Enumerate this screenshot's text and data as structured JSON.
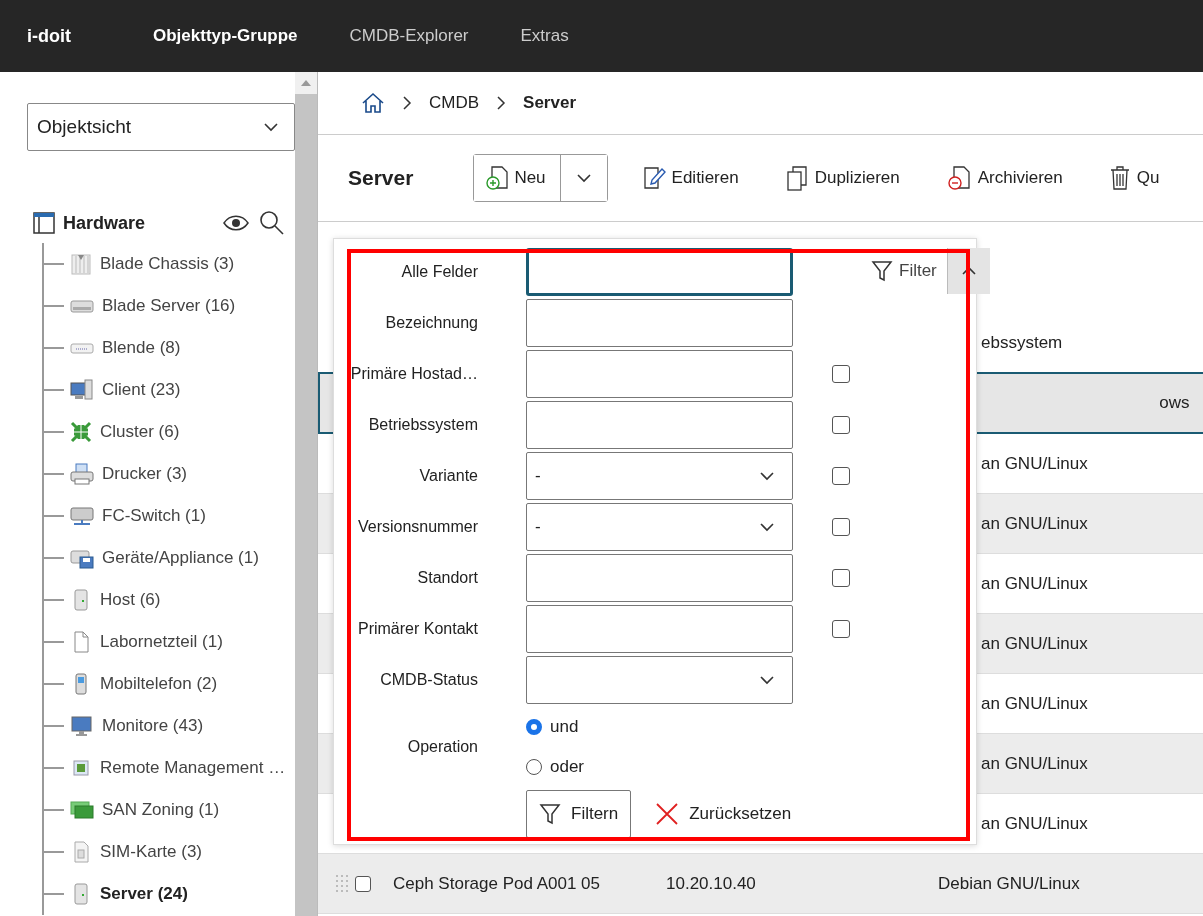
{
  "topbar": {
    "logo": "i-doit",
    "nav": [
      {
        "label": "Objekttyp-Gruppe",
        "selected": true
      },
      {
        "label": "CMDB-Explorer",
        "selected": false
      },
      {
        "label": "Extras",
        "selected": false
      }
    ]
  },
  "sidebar": {
    "view_select": "Objektsicht",
    "tree": {
      "label": "Hardware",
      "children": [
        {
          "label": "Blade Chassis (3)",
          "kind": "chassis",
          "selected": false
        },
        {
          "label": "Blade Server (16)",
          "kind": "blade",
          "selected": false
        },
        {
          "label": "Blende (8)",
          "kind": "panel",
          "selected": false
        },
        {
          "label": "Client (23)",
          "kind": "client",
          "selected": false
        },
        {
          "label": "Cluster (6)",
          "kind": "cluster",
          "selected": false
        },
        {
          "label": "Drucker (3)",
          "kind": "printer",
          "selected": false
        },
        {
          "label": "FC-Switch (1)",
          "kind": "switch",
          "selected": false
        },
        {
          "label": "Geräte/Appliance (1)",
          "kind": "appliance",
          "selected": false
        },
        {
          "label": "Host (6)",
          "kind": "host",
          "selected": false
        },
        {
          "label": "Labornetzteil (1)",
          "kind": "file",
          "selected": false
        },
        {
          "label": "Mobiltelefon (2)",
          "kind": "phone",
          "selected": false
        },
        {
          "label": "Monitore (43)",
          "kind": "monitor",
          "selected": false
        },
        {
          "label": "Remote Management …",
          "kind": "remote",
          "selected": false
        },
        {
          "label": "SAN Zoning (1)",
          "kind": "san",
          "selected": false
        },
        {
          "label": "SIM-Karte (3)",
          "kind": "sim",
          "selected": false
        },
        {
          "label": "Server (24)",
          "kind": "host",
          "selected": true
        }
      ]
    }
  },
  "breadcrumb": [
    {
      "label": "CMDB",
      "current": false
    },
    {
      "label": "Server",
      "current": true
    }
  ],
  "toolbar": {
    "title": "Server",
    "buttons": [
      {
        "label": "Neu",
        "kind": "new"
      },
      {
        "label": "Editieren",
        "kind": "edit"
      },
      {
        "label": "Duplizieren",
        "kind": "duplicate"
      },
      {
        "label": "Archivieren",
        "kind": "archive"
      },
      {
        "label": "Qu",
        "kind": "delete"
      }
    ]
  },
  "table": {
    "columns": [
      {
        "label": "ebssystem"
      }
    ],
    "rows": [
      {
        "selected": true,
        "cells": {
          "column_4": "ows"
        }
      },
      {
        "selected": false,
        "cells": {
          "column_4": "an GNU/Linux"
        }
      },
      {
        "selected": false,
        "cells": {
          "column_4": "an GNU/Linux"
        }
      },
      {
        "selected": false,
        "cells": {
          "column_4": "an GNU/Linux"
        }
      },
      {
        "selected": false,
        "cells": {
          "column_4": "an GNU/Linux"
        }
      },
      {
        "selected": false,
        "cells": {
          "column_4": "an GNU/Linux"
        }
      },
      {
        "selected": false,
        "cells": {
          "column_4": "an GNU/Linux"
        }
      },
      {
        "selected": false,
        "cells": {
          "column_4": "an GNU/Linux"
        }
      },
      {
        "selected": false,
        "checked": false,
        "cells": {
          "column_2": "Ceph Storage Pod A001 05",
          "column_3": "10.20.10.40",
          "column_4": "Debian GNU/Linux"
        }
      }
    ]
  },
  "filter_panel": {
    "toggle": {
      "label": "Filter",
      "expanded": true
    },
    "fields": [
      {
        "label": "Alle Felder",
        "kind": "text",
        "focused": true
      },
      {
        "label": "Bezeichnung",
        "kind": "text",
        "focused": false
      },
      {
        "label": "Primäre Hostad…",
        "kind": "text",
        "focused": false,
        "checked": false
      },
      {
        "label": "Betriebssystem",
        "kind": "text",
        "focused": false,
        "checked": false
      },
      {
        "label": "Variante",
        "kind": "select",
        "value": "-",
        "focused": false,
        "checked": false
      },
      {
        "label": "Versionsnummer",
        "kind": "select",
        "value": "-",
        "focused": false,
        "checked": false
      },
      {
        "label": "Standort",
        "kind": "text",
        "focused": false,
        "checked": false
      },
      {
        "label": "Primärer Kontakt",
        "kind": "text",
        "focused": false,
        "checked": false
      },
      {
        "label": "CMDB-Status",
        "kind": "select",
        "focused": false
      },
      {
        "label": "Operation",
        "kind": "radio",
        "options": [
          {
            "label": "und",
            "selected": true
          },
          {
            "label": "oder",
            "selected": false
          }
        ]
      }
    ],
    "buttons": [
      {
        "label": "Filtern",
        "kind": "apply"
      },
      {
        "label": "Zurücksetzen",
        "kind": "reset"
      }
    ]
  }
}
